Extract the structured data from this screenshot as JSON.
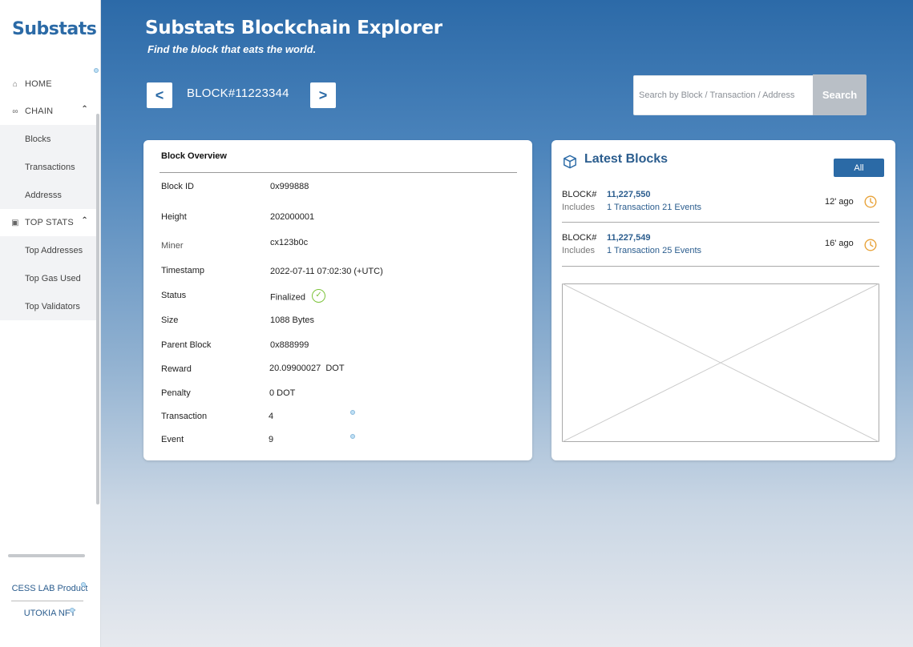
{
  "sidebar": {
    "logo": "Substats",
    "home": "HOME",
    "chain": "CHAIN",
    "chain_items": [
      "Blocks",
      "Transactions",
      "Addresss"
    ],
    "top_stats": "TOP STATS",
    "top_stats_items": [
      "Top Addresses",
      "Top Gas Used",
      "Top Validators"
    ],
    "footer_link_1": "CESS LAB Product",
    "footer_link_2": "UTOKIA NFT"
  },
  "header": {
    "title": "Substats Blockchain Explorer",
    "tagline": "Find the block that eats the world.",
    "block_label": "BLOCK#11223344",
    "prev_glyph": "<",
    "next_glyph": ">",
    "search_placeholder": "Search by Block / Transaction / Address",
    "search_button": "Search"
  },
  "overview": {
    "title": "Block Overview",
    "rows": [
      {
        "key": "Block ID",
        "value": "0x999888"
      },
      {
        "key": "Height",
        "value": "202000001"
      },
      {
        "key": "Miner",
        "value": "cx123b0c"
      },
      {
        "key": "Timestamp",
        "value": "2022-07-11 07:02:30 (+UTC)"
      },
      {
        "key": "Status",
        "value": "Finalized"
      },
      {
        "key": "Size",
        "value": "1088 Bytes"
      },
      {
        "key": "Parent Block",
        "value": "0x888999"
      },
      {
        "key": "Reward",
        "value": "20.09900027  DOT"
      },
      {
        "key": "Penalty",
        "value": "0 DOT"
      },
      {
        "key": "Transaction",
        "value": "4"
      },
      {
        "key": "Event",
        "value": "9"
      }
    ]
  },
  "latest": {
    "title": "Latest Blocks",
    "all_button": "All",
    "blocks": [
      {
        "label": "BLOCK#",
        "number": "11,227,550",
        "includes": "Includes",
        "detail": "1 Transaction 21 Events",
        "ago": "12' ago"
      },
      {
        "label": "BLOCK#",
        "number": "11,227,549",
        "includes": "Includes",
        "detail": "1 Transaction 25 Events",
        "ago": "16' ago"
      }
    ]
  },
  "colors": {
    "accent": "#2b6aa6",
    "success": "#7cc33a",
    "clock": "#e8a33a"
  }
}
